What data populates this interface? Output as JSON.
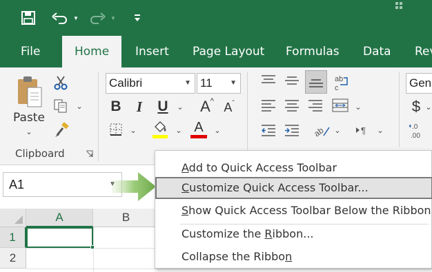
{
  "quick_access": {
    "save_icon": "save-icon",
    "undo_icon": "undo-icon",
    "redo_icon": "redo-icon",
    "customize_icon": "customize-qat-dropdown-icon"
  },
  "tabs": [
    {
      "label": "File"
    },
    {
      "label": "Home",
      "active": true
    },
    {
      "label": "Insert"
    },
    {
      "label": "Page Layout"
    },
    {
      "label": "Formulas"
    },
    {
      "label": "Data"
    },
    {
      "label": "Rev"
    }
  ],
  "ribbon": {
    "clipboard": {
      "paste_label": "Paste",
      "group_label": "Clipboard"
    },
    "font": {
      "font_name": "Calibri",
      "font_size": "11",
      "bold": "B",
      "italic": "I",
      "underline": "U",
      "grow": "A",
      "shrink": "A",
      "font_color_letter": "A"
    },
    "number": {
      "format": "Gene",
      "currency": "$",
      "decimals": ".0\n.00"
    }
  },
  "name_box": {
    "value": "A1"
  },
  "grid": {
    "columns": [
      "A",
      "B"
    ],
    "rows": [
      "1",
      "2"
    ]
  },
  "context_menu": {
    "items": [
      {
        "pre": "",
        "u": "A",
        "post": "dd to Quick Access Toolbar"
      },
      {
        "pre": "",
        "u": "C",
        "post": "ustomize Quick Access Toolbar..."
      },
      {
        "pre": "",
        "u": "S",
        "post": "how Quick Access Toolbar Below the Ribbon"
      },
      {
        "pre": "Customize the ",
        "u": "R",
        "post": "ibbon..."
      },
      {
        "pre": "Collapse the Ribbo",
        "u": "n",
        "post": ""
      }
    ]
  },
  "colors": {
    "excel_green": "#217346",
    "highlight_yellow": "#ffff00",
    "font_red": "#e00000"
  }
}
